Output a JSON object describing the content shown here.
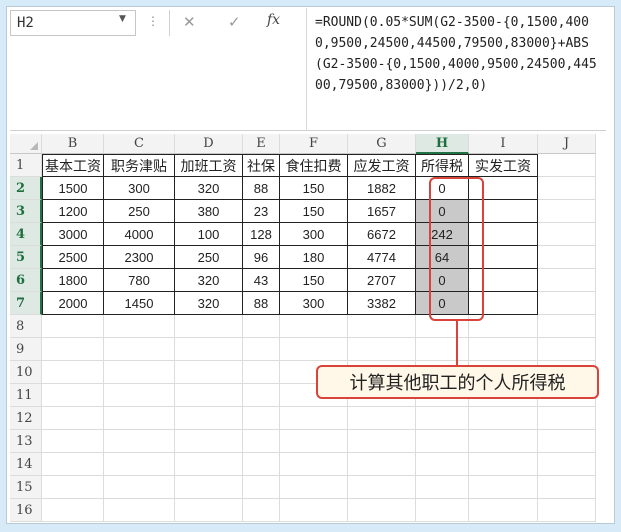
{
  "formula_bar": {
    "name_box": "H2",
    "fx_label": "fx",
    "cancel_icon": "✕",
    "enter_icon": "✓",
    "formula": "=ROUND(0.05*SUM(G2-3500-{0,1500,4000,9500,24500,44500,79500,83000}+ABS(G2-3500-{0,1500,4000,9500,24500,44500,79500,83000}))/2,0)"
  },
  "columns": [
    "B",
    "C",
    "D",
    "E",
    "F",
    "G",
    "H",
    "I",
    "J"
  ],
  "active_column": "H",
  "rows": [
    "1",
    "2",
    "3",
    "4",
    "5",
    "6",
    "7",
    "8",
    "9",
    "10",
    "11",
    "12",
    "13",
    "14",
    "15",
    "16"
  ],
  "table": {
    "headers": [
      "基本工资",
      "职务津贴",
      "加班工资",
      "社保",
      "食住扣费",
      "应发工资",
      "所得税",
      "实发工资"
    ],
    "data": [
      [
        "1500",
        "300",
        "320",
        "88",
        "150",
        "1882",
        "0",
        ""
      ],
      [
        "1200",
        "250",
        "380",
        "23",
        "150",
        "1657",
        "0",
        ""
      ],
      [
        "3000",
        "4000",
        "100",
        "128",
        "300",
        "6672",
        "242",
        ""
      ],
      [
        "2500",
        "2300",
        "250",
        "96",
        "180",
        "4774",
        "64",
        ""
      ],
      [
        "1800",
        "780",
        "320",
        "43",
        "150",
        "2707",
        "0",
        ""
      ],
      [
        "2000",
        "1450",
        "320",
        "88",
        "300",
        "3382",
        "0",
        ""
      ]
    ]
  },
  "callout": {
    "text": "计算其他职工的个人所得税"
  },
  "colors": {
    "accent": "#217346",
    "highlight": "#d9433a",
    "selection": "#c9c9c9"
  }
}
